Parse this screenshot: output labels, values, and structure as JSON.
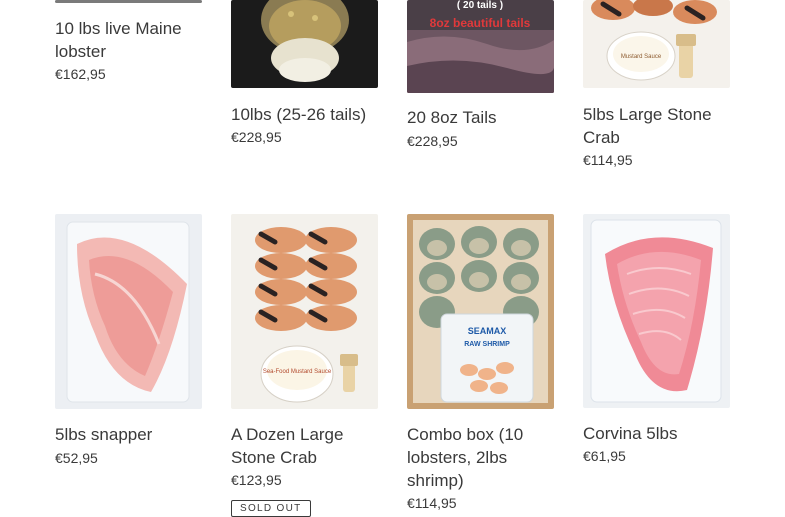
{
  "products": [
    {
      "title": "10 lbs live Maine lobster",
      "price": "€162,95"
    },
    {
      "title": "10lbs (25-26 tails)",
      "price": "€228,95"
    },
    {
      "title": "20 8oz Tails",
      "price": "€228,95",
      "image_text": "( 20 tails )",
      "image_subtext": "8oz beautiful tails"
    },
    {
      "title": "5lbs Large Stone Crab",
      "price": "€114,95"
    },
    {
      "title": "5lbs snapper",
      "price": "€52,95"
    },
    {
      "title": "A Dozen Large Stone Crab",
      "price": "€123,95",
      "badge": "SOLD OUT",
      "image_text": "Sea-Food Mustard Sauce"
    },
    {
      "title": "Combo box (10 lobsters, 2lbs shrimp)",
      "price": "€114,95",
      "image_text": "SEAMAX",
      "image_subtext": "RAW SHRIMP"
    },
    {
      "title": "Corvina 5lbs",
      "price": "€61,95"
    }
  ],
  "colors": {
    "text": "#3a3a3a",
    "background": "#ffffff"
  }
}
